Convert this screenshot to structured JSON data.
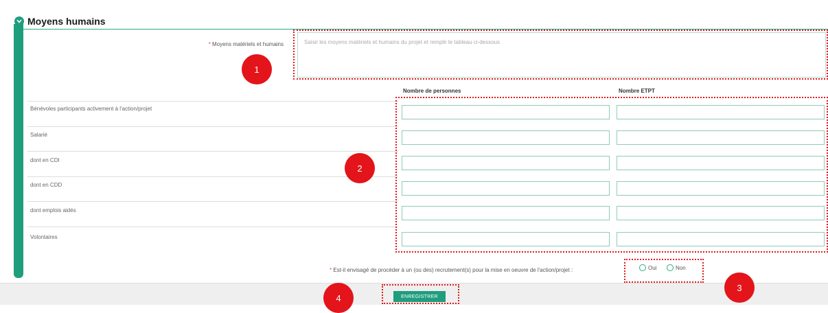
{
  "section": {
    "title": "Moyens humains"
  },
  "means_field": {
    "label": "Moyens matériels et humains",
    "required_mark": "*",
    "placeholder": "Saisir les moyens matériels et humains du projet et remplir le tableau ci-dessous"
  },
  "table": {
    "columns": [
      "Nombre de personnes",
      "Nombre ETPT"
    ],
    "rows": [
      "Bénévoles participants activement à l'action/projet",
      "Salarié",
      "dont en CDI",
      "dont en CDD",
      "dont emplois aidés",
      "Volontaires"
    ]
  },
  "recruitment": {
    "required_mark": "*",
    "question": "Est-il envisagé de procéder à un (ou des) recrutement(s) pour la mise en oeuvre de l'action/projet :",
    "options": [
      "Oui",
      "Non"
    ]
  },
  "footer": {
    "save_label": "ENREGISTRER"
  },
  "annotations": [
    "1",
    "2",
    "3",
    "4"
  ],
  "colors": {
    "accent": "#1f9e7e",
    "annotation_red": "#e3141a"
  }
}
